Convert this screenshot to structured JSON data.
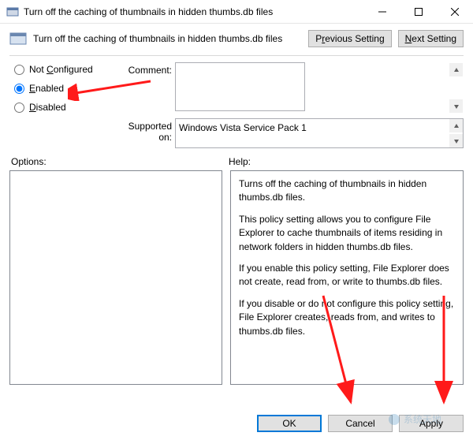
{
  "window": {
    "title": "Turn off the caching of thumbnails in hidden thumbs.db files"
  },
  "header": {
    "title": "Turn off the caching of thumbnails in hidden thumbs.db files",
    "prev_pre": "P",
    "prev_ul": "r",
    "prev_post": "evious Setting",
    "next_ul": "N",
    "next_post": "ext Setting"
  },
  "radios": {
    "notconf_pre": "Not ",
    "notconf_ul": "C",
    "notconf_post": "onfigured",
    "enabled_ul": "E",
    "enabled_post": "nabled",
    "disabled_ul": "D",
    "disabled_post": "isabled",
    "selected": "enabled"
  },
  "labels": {
    "comment": "Comment:",
    "supported": "Supported on:",
    "options": "Options:",
    "help": "Help:"
  },
  "supported_text": "Windows Vista Service Pack 1",
  "help": {
    "p1": "Turns off the caching of thumbnails in hidden thumbs.db files.",
    "p2": "This policy setting allows you to configure File Explorer to cache thumbnails of items residing in network folders in hidden thumbs.db files.",
    "p3": "If you enable this policy setting, File Explorer does not create, read from, or write to thumbs.db files.",
    "p4": "If you disable or do not configure this policy setting, File Explorer creates, reads from, and writes to thumbs.db files."
  },
  "footer": {
    "ok": "OK",
    "cancel": "Cancel",
    "apply": "Apply"
  },
  "watermark": "系统天地"
}
